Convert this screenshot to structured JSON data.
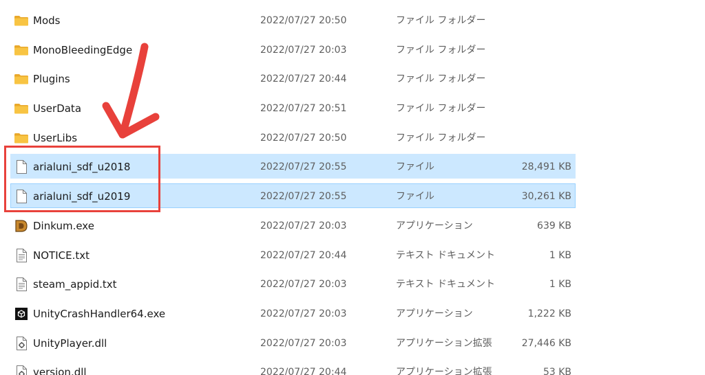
{
  "files": [
    {
      "name": "Mods",
      "date": "2022/07/27 20:50",
      "type": "ファイル フォルダー",
      "size": "",
      "icon": "folder-icon"
    },
    {
      "name": "MonoBleedingEdge",
      "date": "2022/07/27 20:03",
      "type": "ファイル フォルダー",
      "size": "",
      "icon": "folder-icon"
    },
    {
      "name": "Plugins",
      "date": "2022/07/27 20:44",
      "type": "ファイル フォルダー",
      "size": "",
      "icon": "folder-icon"
    },
    {
      "name": "UserData",
      "date": "2022/07/27 20:51",
      "type": "ファイル フォルダー",
      "size": "",
      "icon": "folder-icon"
    },
    {
      "name": "UserLibs",
      "date": "2022/07/27 20:50",
      "type": "ファイル フォルダー",
      "size": "",
      "icon": "folder-icon"
    },
    {
      "name": "arialuni_sdf_u2018",
      "date": "2022/07/27 20:55",
      "type": "ファイル",
      "size": "28,491 KB",
      "icon": "blank-file-icon",
      "selected": true
    },
    {
      "name": "arialuni_sdf_u2019",
      "date": "2022/07/27 20:55",
      "type": "ファイル",
      "size": "30,261 KB",
      "icon": "blank-file-icon",
      "selected": true,
      "focused": true
    },
    {
      "name": "Dinkum.exe",
      "date": "2022/07/27 20:03",
      "type": "アプリケーション",
      "size": "639 KB",
      "icon": "dinkum-app-icon"
    },
    {
      "name": "NOTICE.txt",
      "date": "2022/07/27 20:44",
      "type": "テキスト ドキュメント",
      "size": "1 KB",
      "icon": "text-file-icon"
    },
    {
      "name": "steam_appid.txt",
      "date": "2022/07/27 20:03",
      "type": "テキスト ドキュメント",
      "size": "1 KB",
      "icon": "text-file-icon"
    },
    {
      "name": "UnityCrashHandler64.exe",
      "date": "2022/07/27 20:03",
      "type": "アプリケーション",
      "size": "1,222 KB",
      "icon": "unity-app-icon"
    },
    {
      "name": "UnityPlayer.dll",
      "date": "2022/07/27 20:03",
      "type": "アプリケーション拡張",
      "size": "27,446 KB",
      "icon": "dll-file-icon"
    },
    {
      "name": "version.dll",
      "date": "2022/07/27 20:44",
      "type": "アプリケーション拡張",
      "size": "53 KB",
      "icon": "dll-file-icon"
    }
  ],
  "colors": {
    "selection": "#cce8ff",
    "selection_border": "#99d1ff",
    "annotation": "#e8413b",
    "folder": "#f8c443"
  }
}
